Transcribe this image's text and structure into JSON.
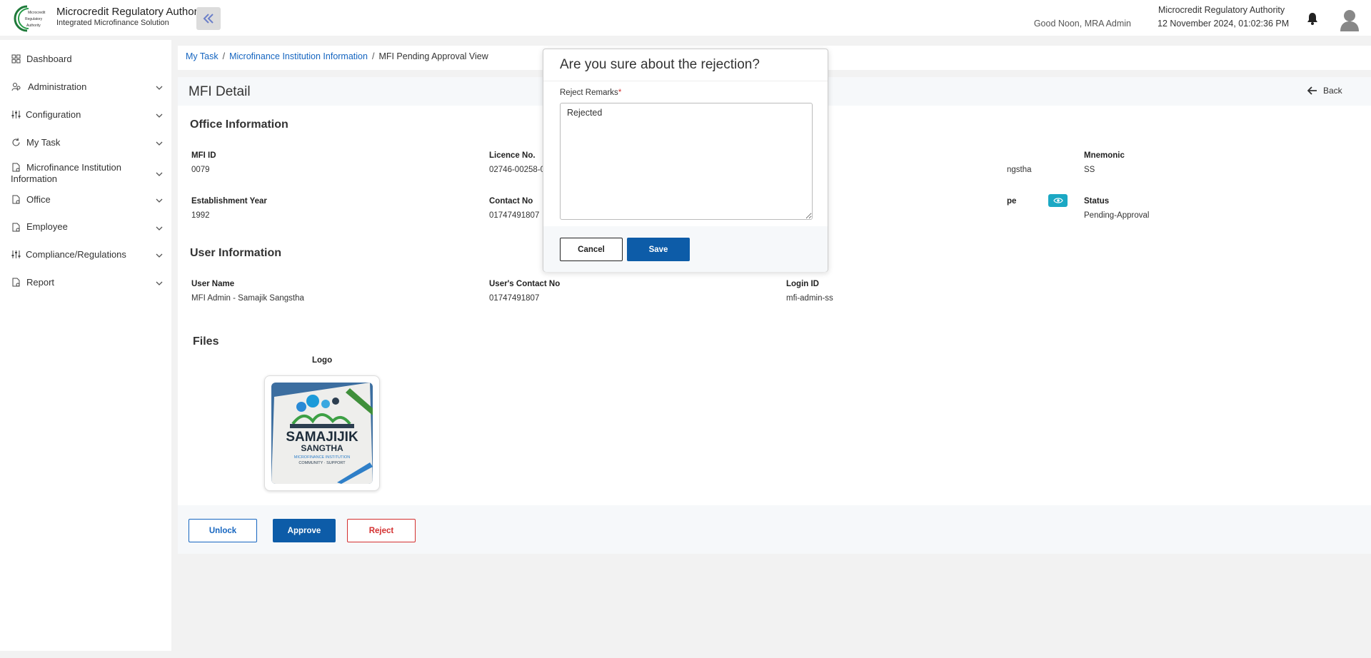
{
  "header": {
    "logo_text": [
      "Microcredit",
      "Regulatory",
      "Authority"
    ],
    "brand_title": "Microcredit Regulatory Authority",
    "brand_subtitle": "Integrated Microfinance Solution",
    "greeting": "Good Noon, MRA Admin",
    "org_name": "Microcredit Regulatory Authority",
    "datetime": "12 November 2024, 01:02:36 PM",
    "icons": [
      "double-chevron-left-icon",
      "bell-icon",
      "user-avatar-icon"
    ]
  },
  "sidebar": {
    "items": [
      {
        "label": "Dashboard",
        "icon": "grid-icon",
        "expandable": false
      },
      {
        "label": "Administration",
        "icon": "users-icon",
        "expandable": true
      },
      {
        "label": "Configuration",
        "icon": "sliders-icon",
        "expandable": true
      },
      {
        "label": "My Task",
        "icon": "refresh-icon",
        "expandable": true
      },
      {
        "label": "Microfinance Institution Information",
        "icon": "document-icon",
        "expandable": true
      },
      {
        "label": "Office",
        "icon": "document-icon",
        "expandable": true
      },
      {
        "label": "Employee",
        "icon": "document-icon",
        "expandable": true
      },
      {
        "label": "Compliance/Regulations",
        "icon": "sliders-icon",
        "expandable": true
      },
      {
        "label": "Report",
        "icon": "document-icon",
        "expandable": true
      }
    ]
  },
  "breadcrumb": {
    "items": [
      "My Task",
      "Microfinance Institution Information"
    ],
    "current": "MFI Pending Approval View"
  },
  "panel": {
    "title": "MFI Detail",
    "back_label": "Back"
  },
  "office_info": {
    "title": "Office Information",
    "fields": [
      {
        "label": "MFI ID",
        "value": "0079"
      },
      {
        "label": "Licence No.",
        "value": "02746-00258-0"
      },
      {
        "label": "",
        "value": "ngstha"
      },
      {
        "label": "Mnemonic",
        "value": "SS"
      },
      {
        "label": "Establishment Year",
        "value": "1992"
      },
      {
        "label": "Contact No",
        "value": "01747491807"
      },
      {
        "label": "pe",
        "value": ""
      },
      {
        "label": "Status",
        "value": "Pending-Approval"
      }
    ]
  },
  "user_info": {
    "title": "User Information",
    "fields": [
      {
        "label": "User Name",
        "value": "MFI Admin - Samajik Sangstha"
      },
      {
        "label": "User's Contact No",
        "value": "01747491807"
      },
      {
        "label": "Login ID",
        "value": "mfi-admin-ss"
      }
    ]
  },
  "files": {
    "title": "Files",
    "logo_label": "Logo",
    "logo_text": {
      "line1": "SAMAJIJIK",
      "line2": "SANGTHA",
      "line3": "MICROFINANCE INSTITUTION",
      "line4": "COMMUNITY · SUPPORT"
    }
  },
  "actions": {
    "unlock": "Unlock",
    "approve": "Approve",
    "reject": "Reject"
  },
  "modal": {
    "title": "Are you sure about the rejection?",
    "label": "Reject Remarks",
    "required_mark": "*",
    "remarks_value": "Rejected",
    "cancel": "Cancel",
    "save": "Save"
  },
  "colors": {
    "primary": "#0d5ca8",
    "link": "#1565c0",
    "danger": "#d32f2f",
    "accent_teal": "#1ba8c4"
  }
}
